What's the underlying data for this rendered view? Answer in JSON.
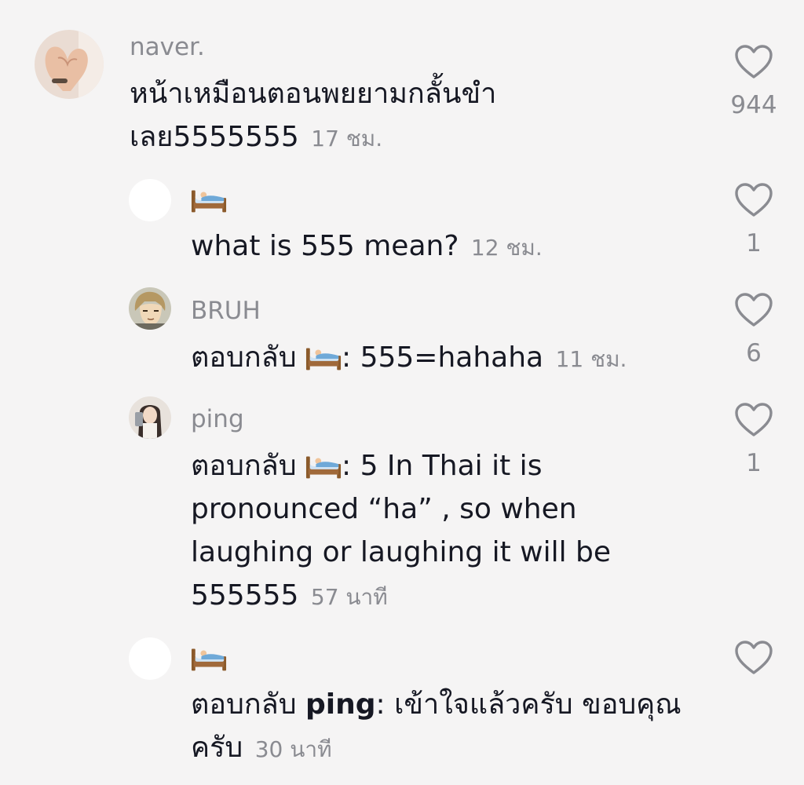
{
  "comments": [
    {
      "username": "naver.",
      "text": "หน้าเหมือนตอนพยยามกลั้นขำเลย5555555",
      "time": "17 ชม.",
      "likes": "944",
      "avatar_icon": "hands-heart-photo"
    },
    {
      "username_icon": "bed-emoji",
      "text": "what is 555 mean?",
      "time": "12 ชม.",
      "likes": "1",
      "avatar_icon": "blank-avatar"
    },
    {
      "username": "BRUH",
      "reply_prefix": "ตอบกลับ",
      "reply_to_icon": "bed-emoji",
      "text": ": 555=hahaha",
      "time": "11 ชม.",
      "likes": "6",
      "avatar_icon": "anime-character-photo"
    },
    {
      "username": "ping",
      "reply_prefix": "ตอบกลับ",
      "reply_to_icon": "bed-emoji",
      "text": ": 5 In Thai it is pronounced “ha” , so when laughing or laughing it will be 555555",
      "time": "57 นาที",
      "likes": "1",
      "avatar_icon": "girl-selfie-photo"
    },
    {
      "username_icon": "bed-emoji",
      "reply_prefix": "ตอบกลับ",
      "reply_to": "ping",
      "text": ": เข้าใจแล้วครับ ขอบคุณครับ",
      "time": "30 นาที",
      "likes": "",
      "avatar_icon": "blank-avatar"
    }
  ],
  "colors": {
    "background": "#f5f4f4",
    "text": "#161823",
    "muted": "#8a8b91"
  }
}
